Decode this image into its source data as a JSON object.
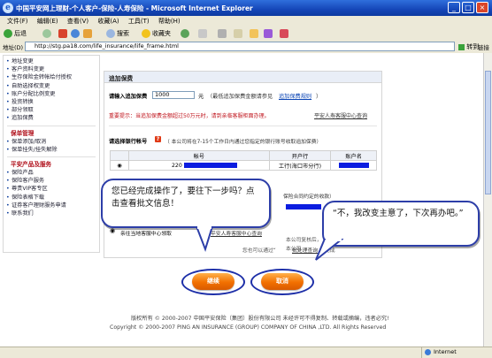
{
  "window": {
    "title": "中国平安网上理财-个人客户-保险-人寿保险 - Microsoft Internet Explorer",
    "controls": [
      "_",
      "□",
      "×"
    ]
  },
  "menubar": [
    "文件(F)",
    "编辑(E)",
    "查看(V)",
    "收藏(A)",
    "工具(T)",
    "帮助(H)"
  ],
  "toolbar": {
    "back": "后退",
    "search": "搜索",
    "favorites": "收藏夹"
  },
  "addressbar": {
    "label": "地址(D)",
    "url": "http://stg.pa18.com/life_insurance/life_frame.html",
    "go": "转到",
    "links": "链接"
  },
  "sidebar": {
    "group1": [
      "地址变更",
      "客户资料变更",
      "生存保险金转帐给付授权",
      "自助选择权变更",
      "账户分配比例变更",
      "投资转换",
      "部分领取",
      "追加保费"
    ],
    "heading2": "保单管理",
    "group2": [
      "保单添加/取消",
      "保单挂失/挂失解除"
    ],
    "heading3": "平安产品及服务",
    "group3": [
      "保险产品",
      "保险客户服务",
      "尊贵VIP客专区",
      "保险表格下载",
      "证券客户理财服务申请",
      "联系我们"
    ]
  },
  "panel": {
    "title": "追加保费",
    "amount_label": "请输入追加保费",
    "amount_value": "1000",
    "amount_unit": "元",
    "amount_hint": "（最低追加保费金额请参见",
    "amount_link": "追加保费规则",
    "amount_hint_end": "）",
    "notice": "重要提示：当追加保费金额超过50万元时，请到亲临客服柜面办理。",
    "service_link": "平安人寿客服中心查询",
    "bank_label": "请选择银行帐号",
    "bank_hint": "（ 本公司将在7-15个工作日内通过您指定的银行账号收取追加保费）",
    "table_headers": [
      "帐号",
      "开户行",
      "账户名"
    ],
    "account_prefix": "220",
    "bank_branch": "工行(海口市分行)",
    "contract_hint": "保险合同约定的收款）",
    "confirm_line1": "本公司复核后，",
    "confirm_line2": "本公司",
    "confirm_line3": "您也可以通过“",
    "confirm_link": "批处理查询",
    "confirm_line4": "”完成",
    "option_label": "亲往当地客服中心领取",
    "option_link": "平安人寿客服中心查询"
  },
  "bubble_left": "您已经完成操作了，要往下一步吗？点击查看批文信息！",
  "bubble_right": "“不，我改变主意了，下次再办吧。”",
  "buttons": {
    "continue": "继续",
    "cancel": "取消"
  },
  "footer": {
    "line1": "版权所有 © 2000-2007 中国平安保险（集团）股份有限公司 未经许可不得复制、转载或摘编，违者必究!",
    "line2": "Copyright © 2000-2007 PING AN INSURANCE (GROUP) COMPANY OF CHINA ,LTD. All Rights Reserved"
  },
  "statusbar": {
    "zone": "Internet"
  },
  "colors": {
    "accent_red": "#c0151d",
    "link_blue": "#0b45b5",
    "button_orange": "#f27000",
    "ring_blue": "#1d2fa8"
  }
}
